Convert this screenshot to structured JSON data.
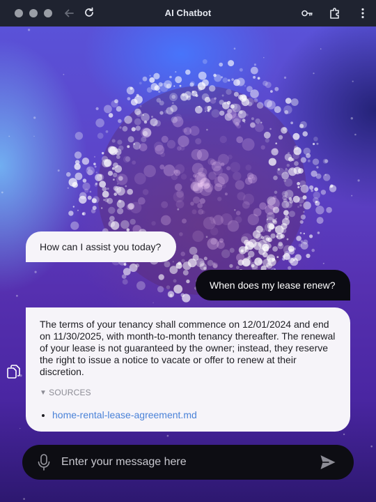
{
  "window": {
    "title": "AI Chatbot"
  },
  "titlebar": {
    "icons": [
      "back-arrow-icon",
      "reload-icon",
      "key-icon",
      "extension-icon",
      "more-icon"
    ]
  },
  "chat": {
    "greeting": "How can I assist you today?",
    "user_message": "When does my lease renew?",
    "answer": "The terms of your tenancy shall commence on 12/01/2024 and end on 11/30/2025, with month-to-month tenancy thereafter. The renewal of your lease is not guaranteed by the owner; instead, they reserve the right to issue a notice to vacate or offer to renew at their discretion.",
    "sources_label": "SOURCES",
    "sources": [
      {
        "label": "home-rental-lease-agreement.md"
      }
    ]
  },
  "input": {
    "placeholder": "Enter your message here",
    "value": ""
  },
  "colors": {
    "titlebar": "#1f2330",
    "bot_bubble": "#f6f4f9",
    "user_bubble": "#0b0b12",
    "link": "#4a82d8",
    "input_bar": "#0d0d13"
  }
}
